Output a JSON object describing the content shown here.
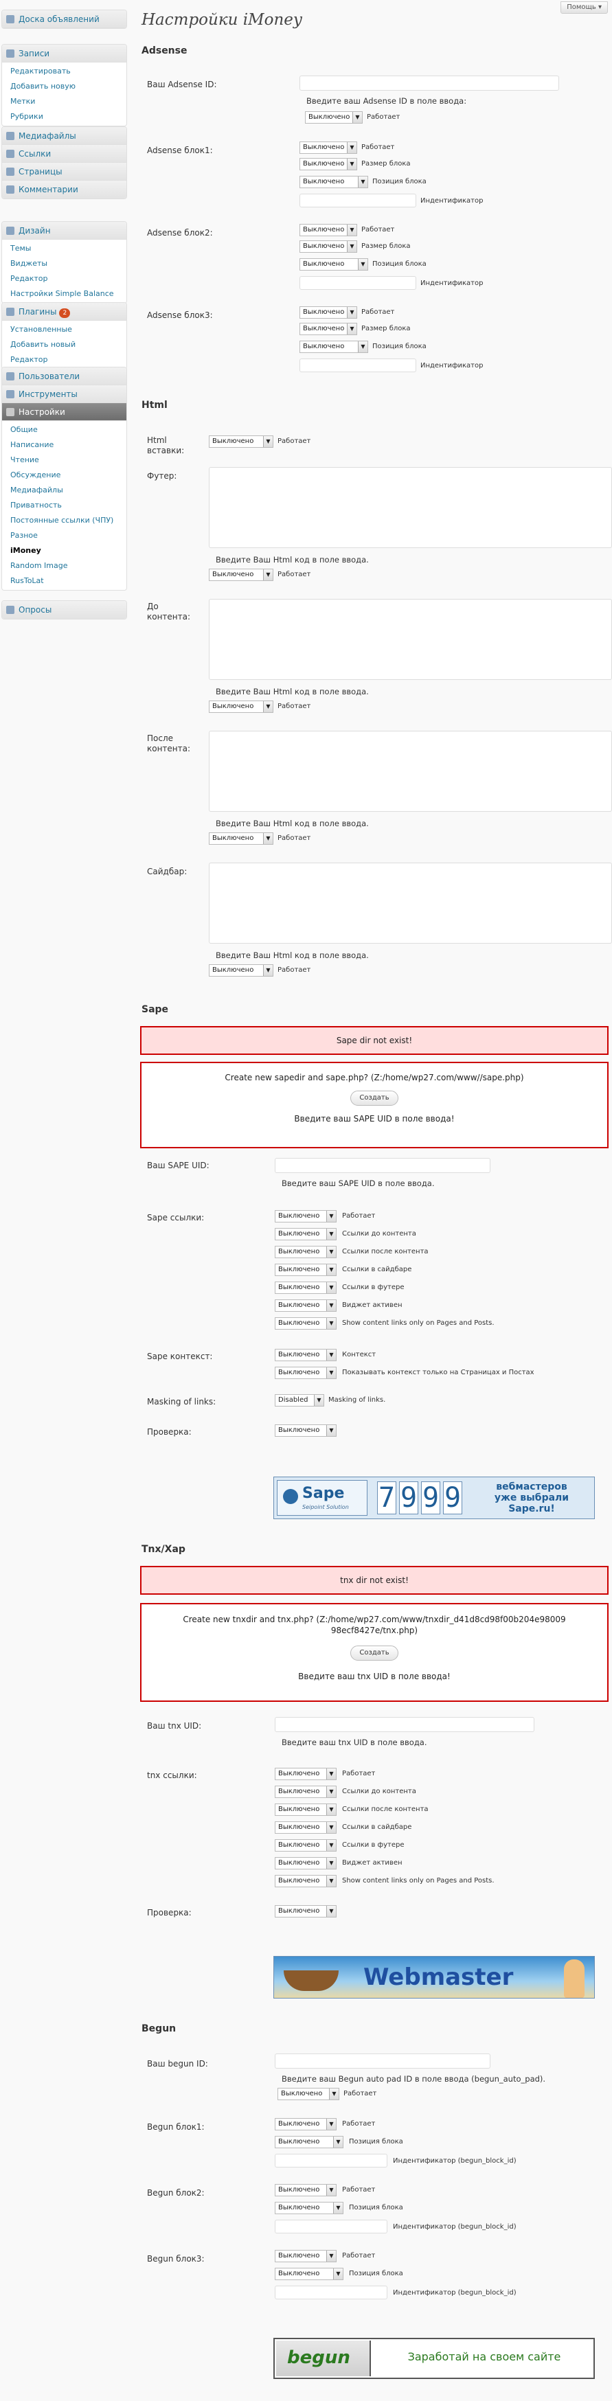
{
  "sidebar": {
    "dashboard": "Доска объявлений",
    "posts": {
      "label": "Записи",
      "items": [
        "Редактировать",
        "Добавить новую",
        "Метки",
        "Рубрики"
      ]
    },
    "media": "Медиафайлы",
    "links": "Ссылки",
    "pages": "Страницы",
    "comments": "Комментарии",
    "design": {
      "label": "Дизайн",
      "items": [
        "Темы",
        "Виджеты",
        "Редактор",
        "Настройки Simple Balance"
      ]
    },
    "plugins": {
      "label": "Плагины",
      "badge": "2",
      "items": [
        "Установленные",
        "Добавить новый",
        "Редактор"
      ]
    },
    "users": "Пользователи",
    "tools": "Инструменты",
    "settings": {
      "label": "Настройки",
      "items": [
        "Общие",
        "Написание",
        "Чтение",
        "Обсуждение",
        "Медиафайлы",
        "Приватность",
        "Постоянные ссылки (ЧПУ)",
        "Разное",
        "iMoney",
        "Random Image",
        "RusToLat"
      ]
    },
    "polls": "Опросы"
  },
  "header": {
    "help": "Помощь ▾",
    "title": "Настройки iMoney"
  },
  "select": {
    "off": "Выключено",
    "disabled": "Disabled"
  },
  "adsense": {
    "title": "Adsense",
    "id_label": "Ваш Adsense ID:",
    "id_hint": "Введите ваш Adsense ID в поле ввода:",
    "works": "Работает",
    "block_size": "Размер блока",
    "block_pos": "Позиция блока",
    "identifier": "Индентификатор",
    "block1": "Adsense блок1:",
    "block2": "Adsense блок2:",
    "block3": "Adsense блок3:"
  },
  "html": {
    "title": "Html",
    "inserts_label": "Html вставки:",
    "works": "Работает",
    "footer": "Футер:",
    "before": "До контента:",
    "after": "После контента:",
    "sidebar": "Сайдбар:",
    "hint": "Введите Ваш Html код в поле ввода."
  },
  "sape": {
    "title": "Sape",
    "error": "Sape dir not exist!",
    "create_text": "Create new sapedir and sape.php? (Z:/home/wp27.com/www//sape.php)",
    "create_btn": "Создать",
    "uid_prompt": "Введите ваш SAPE UID в поле ввода!",
    "uid_label": "Ваш SAPE UID:",
    "uid_hint": "Введите ваш SAPE UID в поле ввода.",
    "links_label": "Sape ссылки:",
    "links_opts": [
      "Работает",
      "Ссылки до контента",
      "Ссылки после контента",
      "Ссылки в сайдбаре",
      "Ссылки в футере",
      "Виджет активен",
      "Show content links only on Pages and Posts."
    ],
    "context_label": "Sape контекст:",
    "context_opts": [
      "Контекст",
      "Показывать контекст только на Страницах и Постах"
    ],
    "masking_label": "Masking of links:",
    "masking_opt": "Masking of links.",
    "check_label": "Проверка:",
    "banner": {
      "brand": "Sape",
      "sub": "Seipoint Solution",
      "digits": [
        "7",
        "9",
        "9",
        "9"
      ],
      "line1": "вебмастеров",
      "line2": "уже выбрали",
      "line3": "Sape.ru!"
    }
  },
  "tnx": {
    "title": "Tnx/Xap",
    "error": "tnx dir not exist!",
    "create_text": "Create new tnxdir and tnx.php? (Z:/home/wp27.com/www/tnxdir_d41d8cd98f00b204e9800998ecf8427e/tnx.php)",
    "create_btn": "Создать",
    "uid_prompt": "Введите ваш tnx UID в поле ввода!",
    "uid_label": "Ваш tnx UID:",
    "uid_hint": "Введите ваш tnx UID в поле ввода.",
    "links_label": "tnx ссылки:",
    "links_opts": [
      "Работает",
      "Ссылки до контента",
      "Ссылки после контента",
      "Ссылки в сайдбаре",
      "Ссылки в футере",
      "Виджет активен",
      "Show content links only on Pages and Posts."
    ],
    "check_label": "Проверка:",
    "banner": "Webmaster"
  },
  "begun": {
    "title": "Begun",
    "id_label": "Ваш begun ID:",
    "id_hint": "Введите ваш Begun auto pad ID в поле ввода (begun_auto_pad).",
    "works": "Работает",
    "block_pos": "Позиция блока",
    "identifier": "Индентификатор (begun_block_id)",
    "block1": "Begun блок1:",
    "block2": "Begun блок2:",
    "block3": "Begun блок3:",
    "banner": {
      "brand": "begun",
      "slogan": "Заработай на своем сайте"
    }
  }
}
